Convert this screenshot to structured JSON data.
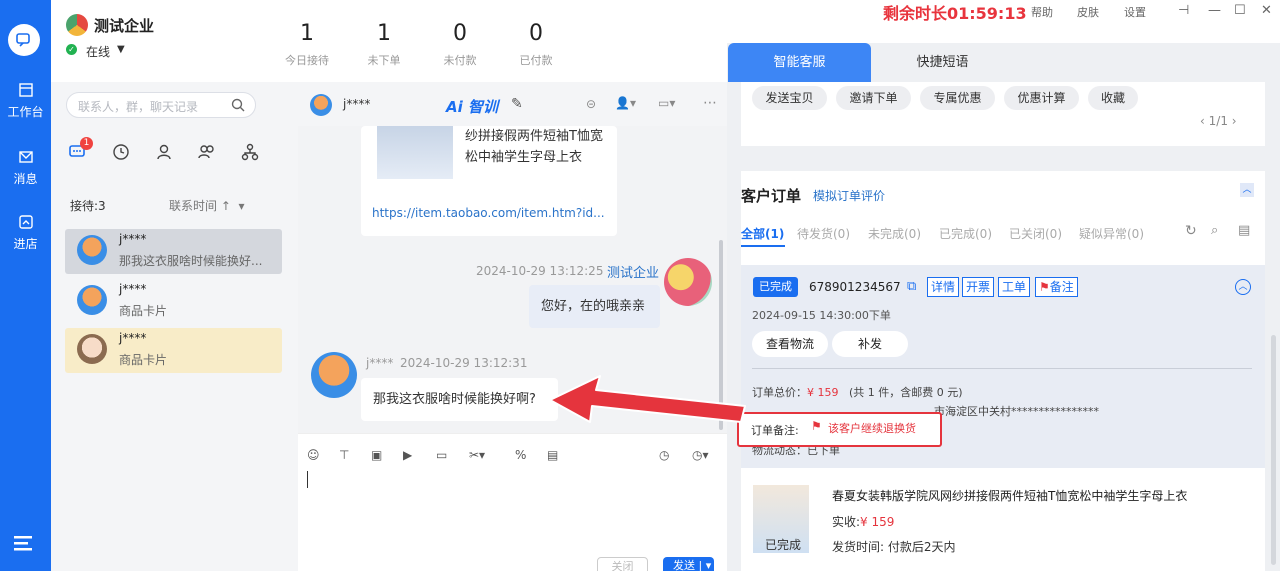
{
  "nav": {
    "items": [
      {
        "label": "工作台",
        "icon": "workbench-icon"
      },
      {
        "label": "消息",
        "icon": "message-icon"
      },
      {
        "label": "进店",
        "icon": "store-icon"
      }
    ]
  },
  "header": {
    "enterprise_name": "测试企业",
    "status": "在线",
    "stats": [
      {
        "value": "1",
        "label": "今日接待"
      },
      {
        "value": "1",
        "label": "未下单"
      },
      {
        "value": "0",
        "label": "未付款"
      },
      {
        "value": "0",
        "label": "已付款"
      }
    ],
    "countdown": "剩余时长01:59:13",
    "links": [
      "帮助",
      "皮肤",
      "设置"
    ]
  },
  "contacts": {
    "search_placeholder": "联系人，群，聊天记录",
    "tab_badge": "1",
    "waiting": "接待:3",
    "sort_label": "联系时间",
    "list": [
      {
        "name": "j****",
        "message": "那我这衣服啥时候能换好..."
      },
      {
        "name": "j****",
        "message": "商品卡片"
      },
      {
        "name": "j****",
        "message": "商品卡片"
      }
    ]
  },
  "chat": {
    "contact_name": "j****",
    "ai_label": "智训",
    "product_card": {
      "title": "纱拼接假两件短袖T恤宽松中袖学生字母上衣",
      "url": "https://item.taobao.com/item.htm?id..."
    },
    "messages": [
      {
        "sender": "测试企业",
        "time": "2024-10-29 13:12:25",
        "text": "您好，在的哦亲亲"
      },
      {
        "sender": "j****",
        "time": "2024-10-29 13:12:31",
        "text": "那我这衣服啥时候能换好啊?"
      }
    ],
    "close_label": "关闭",
    "send_label": "发送"
  },
  "right": {
    "tabs": [
      "智能客服",
      "快捷短语"
    ],
    "quick_actions": [
      "发送宝贝",
      "邀请下单",
      "专属优惠",
      "优惠计算",
      "收藏"
    ],
    "pagination": "1/1",
    "orders_title": "客户订单",
    "simulate_label": "模拟订单评价",
    "filters": [
      "全部(1)",
      "待发货(0)",
      "未完成(0)",
      "已完成(0)",
      "已关闭(0)",
      "疑似异常(0)"
    ],
    "order": {
      "status": "已完成",
      "number": "678901234567",
      "tags": [
        "详情",
        "开票",
        "工单",
        "备注"
      ],
      "date": "2024-09-15 14:30:00下单",
      "buttons": [
        "查看物流",
        "补发"
      ],
      "total_label": "订单总价：",
      "total_amount": "¥ 159",
      "total_note": "(共 1 件，含邮费 0 元)",
      "address_partial": "市海淀区中关村****************",
      "remark_label": "订单备注:",
      "remark_text": "该客户继续退换货",
      "logistics": "物流动态：已下单"
    },
    "product": {
      "title": "春夏女装韩版学院风网纱拼接假两件短袖T恤宽松中袖学生字母上衣",
      "paid_label": "实收:",
      "paid_amount": "¥ 159",
      "ship_label": "发货时间:",
      "ship_value": "付款后2天内",
      "status": "已完成"
    }
  },
  "colors": {
    "primary": "#1a6ef0",
    "alert": "#e5343d"
  }
}
